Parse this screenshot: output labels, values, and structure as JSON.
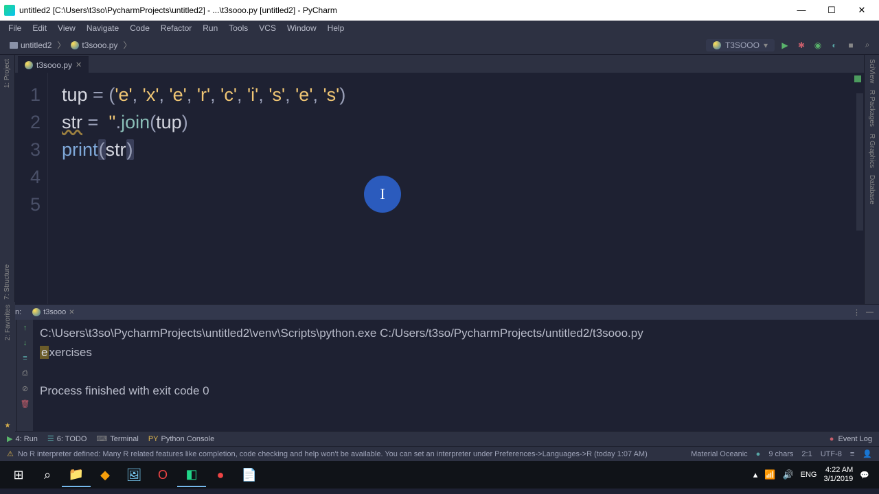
{
  "title": "untitled2 [C:\\Users\\t3so\\PycharmProjects\\untitled2] - ...\\t3sooo.py [untitled2] - PyCharm",
  "menu": [
    "File",
    "Edit",
    "View",
    "Navigate",
    "Code",
    "Refactor",
    "Run",
    "Tools",
    "VCS",
    "Window",
    "Help"
  ],
  "breadcrumb": {
    "project": "untitled2",
    "file": "t3sooo.py"
  },
  "run_config": "T3SOOO",
  "tab": {
    "name": "t3sooo.py"
  },
  "code": {
    "lines": [
      "1",
      "2",
      "3",
      "4",
      "5"
    ],
    "line1_var": "tup",
    "line1_eq": " = ",
    "line1_open": "(",
    "line1_s1": "'e'",
    "line1_c1": ", ",
    "line1_s2": "'x'",
    "line1_c2": ", ",
    "line1_s3": "'e'",
    "line1_c3": ", ",
    "line1_s4": "'r'",
    "line1_c4": ", ",
    "line1_s5": "'c'",
    "line1_c5": ", ",
    "line1_s6": "'i'",
    "line1_c6": ", ",
    "line1_s7": "'s'",
    "line1_c7": ", ",
    "line1_s8": "'e'",
    "line1_c8": ", ",
    "line1_s9": "'s'",
    "line1_close": ")",
    "line2_var": "str",
    "line2_eq": " =  ",
    "line2_empty": "''",
    "line2_dot": ".",
    "line2_join": "join",
    "line2_open": "(",
    "line2_arg": "tup",
    "line2_close": ")",
    "line3_print": "print",
    "line3_open": "(",
    "line3_arg": "str",
    "line3_close": ")"
  },
  "run": {
    "label": "Run:",
    "tab": "t3sooo",
    "cmd": "C:\\Users\\t3so\\PycharmProjects\\untitled2\\venv\\Scripts\\python.exe C:/Users/t3so/PycharmProjects/untitled2/t3sooo.py",
    "output_hl": "e",
    "output_rest": "xercises",
    "finished": "Process finished with exit code 0"
  },
  "bottom_tabs": {
    "run": "4: Run",
    "todo": "6: TODO",
    "terminal": "Terminal",
    "pyconsole": "Python Console",
    "eventlog": "Event Log"
  },
  "status": {
    "warn": "No R interpreter defined: Many R related features like completion, code checking and help won't be available. You can set an interpreter under Preferences->Languages->R (today 1:07 AM)",
    "theme": "Material Oceanic",
    "chars": "9 chars",
    "pos": "2:1",
    "enc": "UTF-8",
    "eol": "≡"
  },
  "side": {
    "project": "1: Project",
    "structure": "7: Structure",
    "favorites": "2: Favorites",
    "scivew": "SciView",
    "rpkg": "R Packages",
    "rgraph": "R Graphics",
    "db": "Database"
  },
  "taskbar": {
    "tray_up": "▴",
    "tray_net": "📶",
    "tray_snd": "🔊",
    "lang": "ENG",
    "time": "4:22 AM",
    "date": "3/1/2019"
  },
  "icons": {
    "play": "▶",
    "bug": "✱",
    "cov": "◉",
    "profile": "◐",
    "stop": "■",
    "find": "⌕",
    "chevron": "▾",
    "gear": "⋮",
    "minimize": "—",
    "maximize": "☐",
    "close": "✕",
    "warn": "⚠",
    "dot": "●",
    "trash": "🗑",
    "print": "⎙",
    "up": "↑",
    "down": "↓",
    "pause": "‖",
    "step": "≡",
    "collapse": "—"
  }
}
